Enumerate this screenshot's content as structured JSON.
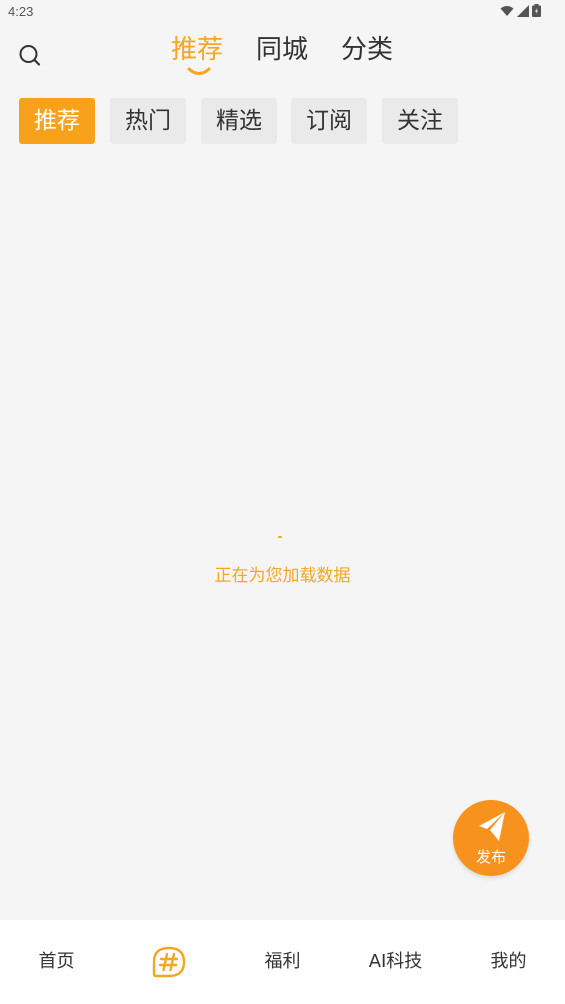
{
  "status_bar": {
    "time": "4:23",
    "icons": [
      "wifi-icon",
      "cell-signal-icon",
      "battery-icon"
    ]
  },
  "header": {
    "search_icon": "search-icon",
    "tabs": [
      {
        "label": "推荐",
        "active": true
      },
      {
        "label": "同城",
        "active": false
      },
      {
        "label": "分类",
        "active": false
      }
    ]
  },
  "chips": [
    {
      "label": "推荐",
      "active": true
    },
    {
      "label": "热门",
      "active": false
    },
    {
      "label": "精选",
      "active": false
    },
    {
      "label": "订阅",
      "active": false
    },
    {
      "label": "关注",
      "active": false
    }
  ],
  "content": {
    "loading_text": "正在为您加载数据"
  },
  "fab": {
    "label": "发布",
    "icon": "paper-plane-icon"
  },
  "bottom_nav": [
    {
      "label": "首页"
    },
    {
      "label": "",
      "icon": "hashtag-icon"
    },
    {
      "label": "福利"
    },
    {
      "label": "AI科技"
    },
    {
      "label": "我的"
    }
  ],
  "colors": {
    "accent": "#f5a623",
    "fab": "#f7921e",
    "chip_bg": "#eaeaea",
    "page_bg": "#f5f5f5"
  }
}
